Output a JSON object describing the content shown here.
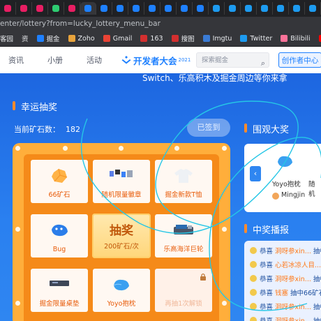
{
  "browser": {
    "url": "enter/lottery?from=lucky_lottery_menu_bar",
    "bookmarks": [
      {
        "label": "客园",
        "color": "#555555"
      },
      {
        "label": "资",
        "color": "#555555"
      },
      {
        "label": "掘金",
        "color": "#1e80ff"
      },
      {
        "label": "Zoho",
        "color": "#e8a33c"
      },
      {
        "label": "Gmail",
        "color": "#ea4335"
      },
      {
        "label": "163",
        "color": "#d32f2f"
      },
      {
        "label": "搜图",
        "color": "#d32f2f"
      },
      {
        "label": "Imgtu",
        "color": "#3a7bd5"
      },
      {
        "label": "Twitter",
        "color": "#1d9bf0"
      },
      {
        "label": "Bilibili",
        "color": "#fb7299"
      },
      {
        "label": "YouTube",
        "color": "#ff0000"
      }
    ]
  },
  "nav": {
    "items": [
      "资讯",
      "小册",
      "活动"
    ],
    "logo": "开发者大会",
    "logo_year": "2021",
    "search_placeholder": "探索掘金",
    "creator_button": "创作者中心"
  },
  "page": {
    "top_text": "Switch、乐高积木及掘金周边等你来拿",
    "lottery_title": "幸运抽奖",
    "ore_label": "当前矿石数：",
    "ore_value": "182",
    "signed_label": "已签到",
    "prizes": [
      {
        "label": "66矿石",
        "icon": "ore-icon"
      },
      {
        "label": "随机限量徽章",
        "icon": "badge-icon"
      },
      {
        "label": "掘金新款T恤",
        "icon": "tshirt-icon"
      },
      {
        "label": "Bug",
        "icon": "bug-icon"
      },
      {
        "label": "乐高海洋巨轮",
        "icon": "lego-icon"
      },
      {
        "label": "掘金限量桌垫",
        "icon": "deskmat-icon"
      },
      {
        "label": "Yoyo抱枕",
        "icon": "pillow-icon"
      },
      {
        "label": "再抽1次解锁",
        "icon": "lock-icon"
      }
    ],
    "draw": {
      "title": "抽奖",
      "cost": "200矿石/次"
    },
    "showcase_title": "围观大奖",
    "showcase": {
      "prize1": "Yoyo抱枕",
      "prize2": "随机",
      "user": "Mingjin"
    },
    "winners_title": "中奖播报",
    "winners": [
      {
        "a": "恭喜",
        "b": "洞呀参xin...",
        "c": "抽中"
      },
      {
        "a": "恭喜",
        "b": "心若冰凉人目...",
        "c": "抽中"
      },
      {
        "a": "恭喜",
        "b": "洞呀参xin...",
        "c": "抽中"
      },
      {
        "a": "恭喜",
        "b": "钱塞",
        "c": "抽中66矿石"
      },
      {
        "a": "恭喜",
        "b": "洞呀参xin...",
        "c": "抽中"
      },
      {
        "a": "恭喜",
        "b": "洞呀参xin...",
        "c": "抽中"
      }
    ]
  },
  "colors": {
    "accent": "#1e80ff",
    "board": "#ffae3b",
    "board_inner": "#f58a19",
    "page_bg": "#1d66e0"
  }
}
